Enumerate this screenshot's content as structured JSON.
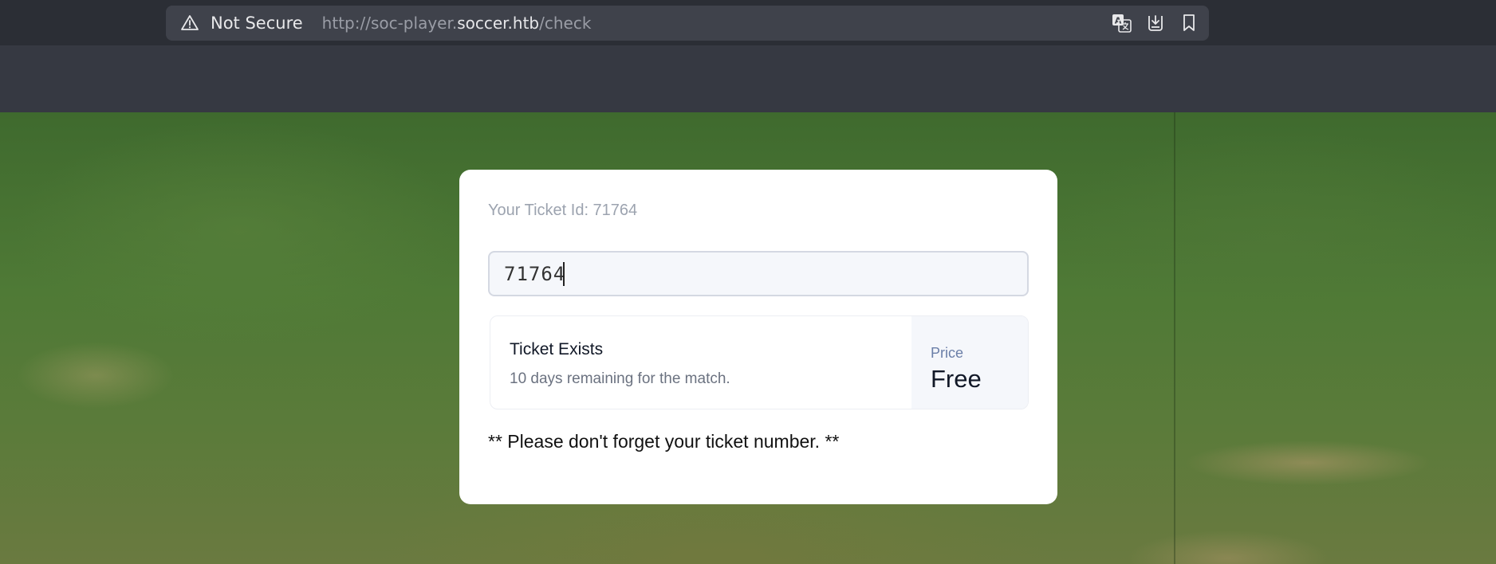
{
  "browser": {
    "security_label": "Not Secure",
    "url_prefix": "http://soc-player.",
    "url_host": "soccer.htb",
    "url_path": "/check",
    "icons": [
      "warning-icon",
      "translate-icon",
      "download-icon",
      "bookmark-icon"
    ]
  },
  "card": {
    "ticket_id_label": "Your Ticket Id: 71764",
    "input_value": "71764",
    "result_title": "Ticket Exists",
    "result_subtitle": "10 days remaining for the match.",
    "price_label": "Price",
    "price_value": "Free",
    "note": "** Please don't forget your ticket number. **"
  }
}
